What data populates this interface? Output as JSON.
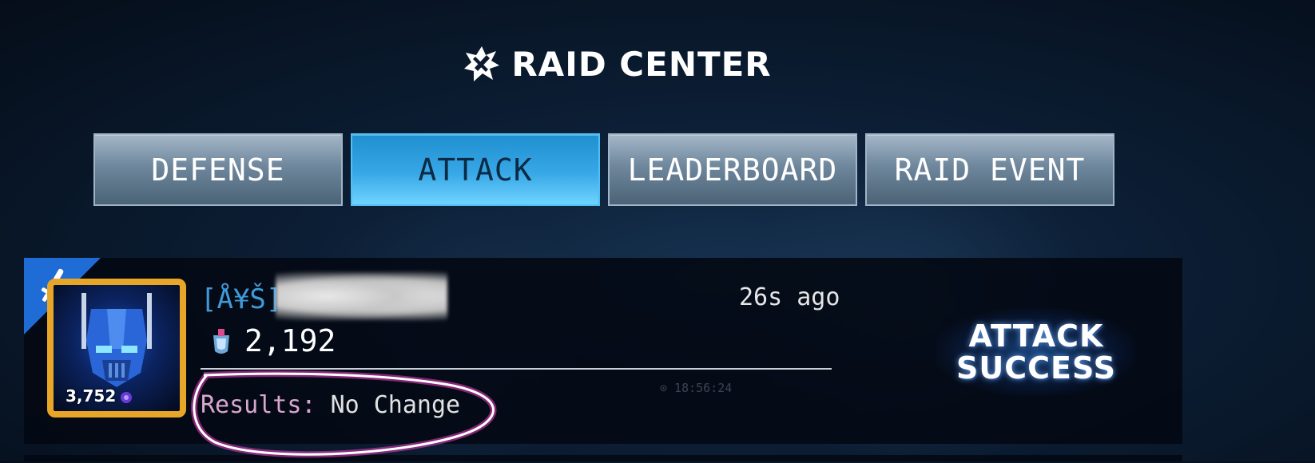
{
  "header": {
    "title": "RAID CENTER",
    "icon": "raid-burst-icon"
  },
  "tabs": [
    {
      "label": "DEFENSE",
      "active": false
    },
    {
      "label": "ATTACK",
      "active": true
    },
    {
      "label": "LEADERBOARD",
      "active": false
    },
    {
      "label": "RAID EVENT",
      "active": false
    }
  ],
  "entry": {
    "type_icon": "sword-icon",
    "portrait_icon": "optimus-helmet-icon",
    "power": "3,752",
    "player_tag": "[Å¥Š]",
    "time_ago": "26s ago",
    "trophies": "2,192",
    "results_label": "Results:",
    "results_value": "No Change",
    "outcome_line1": "ATTACK",
    "outcome_line2": "SUCCESS",
    "faint_timestamp": "⊙ 18:56:24"
  },
  "colors": {
    "active_tab": "#38a7e6",
    "inactive_tab": "#6f879c",
    "portrait_frame": "#e8a628",
    "player_tag": "#3f9bd8",
    "annotation_circle": "#d93bb4",
    "corner_badge": "#1f6cd6"
  }
}
